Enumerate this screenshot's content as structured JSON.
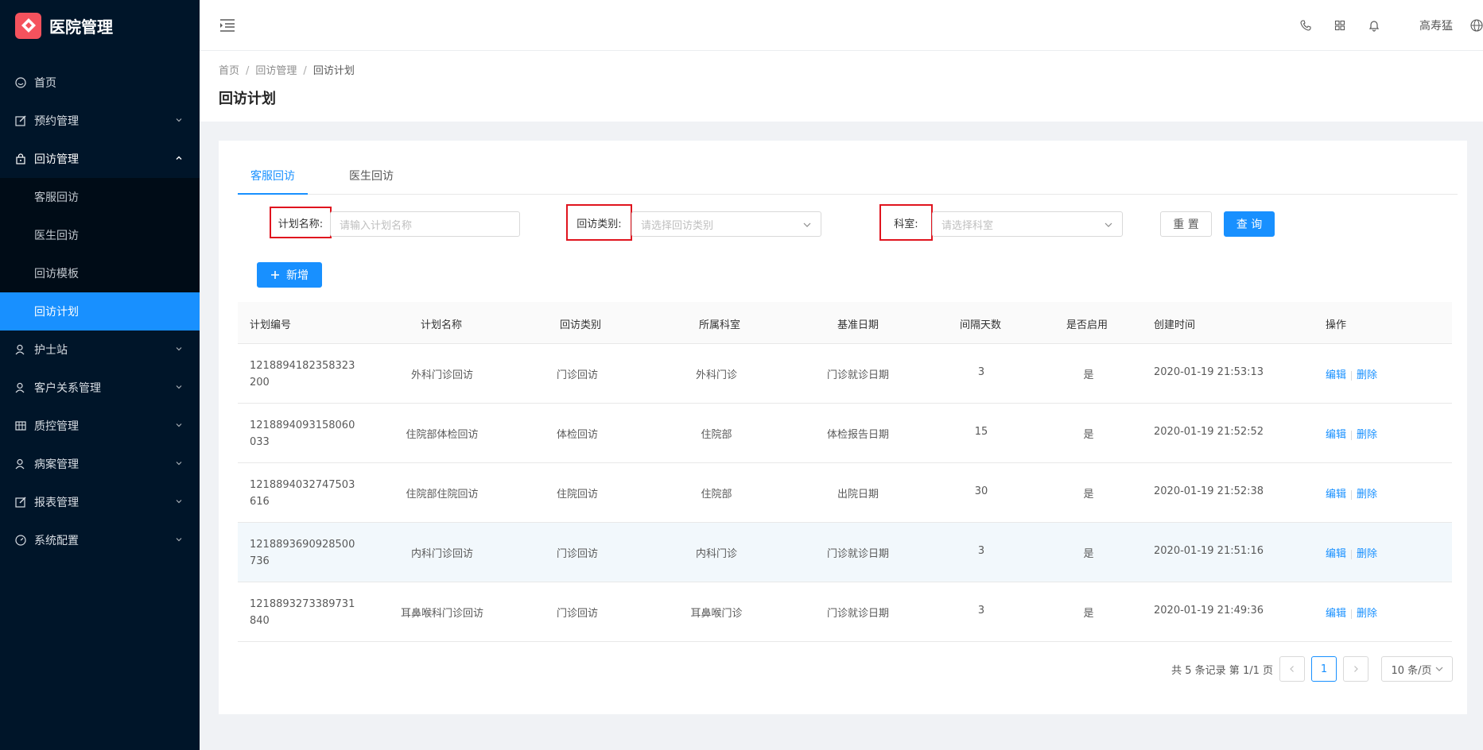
{
  "app": {
    "title": "医院管理"
  },
  "menu": {
    "home": "首页",
    "appointment": "预约管理",
    "followup": "回访管理",
    "followup_children": [
      "客服回访",
      "医生回访",
      "回访模板",
      "回访计划"
    ],
    "nurse_station": "护士站",
    "crm": "客户关系管理",
    "quality": "质控管理",
    "medical_records": "病案管理",
    "reports": "报表管理",
    "system": "系统配置"
  },
  "header": {
    "user": "高寿猛"
  },
  "breadcrumb": {
    "items": [
      "首页",
      "回访管理",
      "回访计划"
    ]
  },
  "page": {
    "title": "回访计划"
  },
  "tabs": [
    "客服回访",
    "医生回访"
  ],
  "filters": {
    "plan_name_label": "计划名称:",
    "plan_name_placeholder": "请输入计划名称",
    "type_label": "回访类别:",
    "type_placeholder": "请选择回访类别",
    "dept_label": "科室:",
    "dept_placeholder": "请选择科室",
    "reset": "重 置",
    "search": "查 询"
  },
  "add_button": "新增",
  "table": {
    "columns": [
      "计划编号",
      "计划名称",
      "回访类别",
      "所属科室",
      "基准日期",
      "间隔天数",
      "是否启用",
      "创建时间",
      "操作"
    ],
    "rows": [
      {
        "id": "1218894182358323200",
        "name": "外科门诊回访",
        "type": "门诊回访",
        "dept": "外科门诊",
        "base_date": "门诊就诊日期",
        "interval": "3",
        "enabled": "是",
        "created": "2020-01-19 21:53:13"
      },
      {
        "id": "1218894093158060033",
        "name": "住院部体检回访",
        "type": "体检回访",
        "dept": "住院部",
        "base_date": "体检报告日期",
        "interval": "15",
        "enabled": "是",
        "created": "2020-01-19 21:52:52"
      },
      {
        "id": "1218894032747503616",
        "name": "住院部住院回访",
        "type": "住院回访",
        "dept": "住院部",
        "base_date": "出院日期",
        "interval": "30",
        "enabled": "是",
        "created": "2020-01-19 21:52:38"
      },
      {
        "id": "1218893690928500736",
        "name": "内科门诊回访",
        "type": "门诊回访",
        "dept": "内科门诊",
        "base_date": "门诊就诊日期",
        "interval": "3",
        "enabled": "是",
        "created": "2020-01-19 21:51:16"
      },
      {
        "id": "1218893273389731840",
        "name": "耳鼻喉科门诊回访",
        "type": "门诊回访",
        "dept": "耳鼻喉门诊",
        "base_date": "门诊就诊日期",
        "interval": "3",
        "enabled": "是",
        "created": "2020-01-19 21:49:36"
      }
    ],
    "edit": "编辑",
    "delete": "删除"
  },
  "pagination": {
    "summary": "共 5 条记录 第 1/1 页",
    "current": "1",
    "page_size": "10 条/页"
  },
  "colors": {
    "primary": "#1890ff",
    "sidebar": "#001529",
    "highlight_box": "#e0141e",
    "logo": "#f5525d"
  }
}
